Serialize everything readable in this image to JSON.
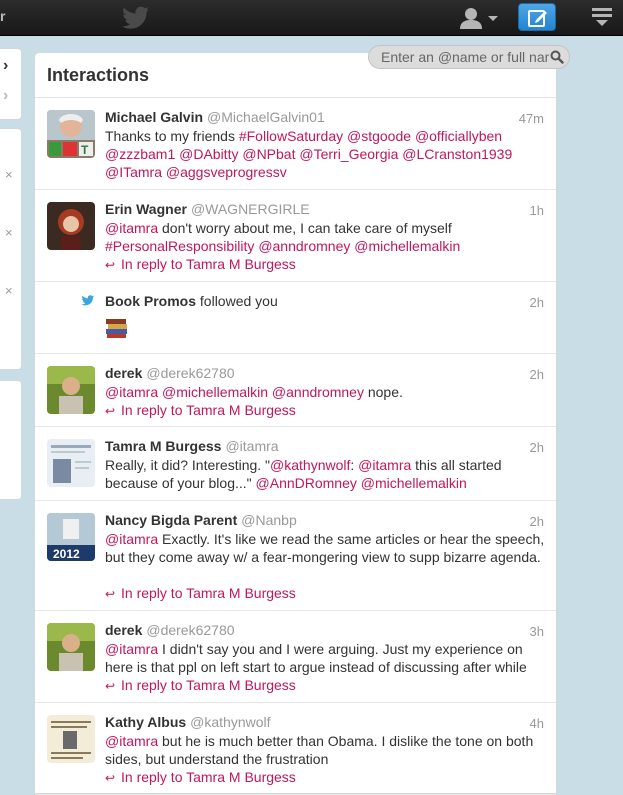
{
  "topbar": {
    "left_cut_text": "r"
  },
  "search": {
    "placeholder": "Enter an @name or full name"
  },
  "panel": {
    "title": "Interactions"
  },
  "items": [
    {
      "name": "Michael Galvin",
      "handle": "@MichaelGalvin01",
      "time": "47m",
      "segments": [
        {
          "t": "Thanks to my friends "
        },
        {
          "t": "#FollowSaturday",
          "m": 1
        },
        {
          "t": " "
        },
        {
          "t": "@stgoode",
          "m": 1
        },
        {
          "t": " "
        },
        {
          "t": "@officiallyben",
          "m": 1
        },
        {
          "t": " "
        },
        {
          "t": "@zzzbam1",
          "m": 1
        },
        {
          "t": " "
        },
        {
          "t": "@DAbitty",
          "m": 1
        },
        {
          "t": " "
        },
        {
          "t": "@NPbat",
          "m": 1
        },
        {
          "t": " "
        },
        {
          "t": "@Terri_Georgia",
          "m": 1
        },
        {
          "t": " "
        },
        {
          "t": "@LCranston1939",
          "m": 1
        },
        {
          "t": " "
        },
        {
          "t": "@ITamra",
          "m": 1
        },
        {
          "t": " "
        },
        {
          "t": "@aggsveprogressv",
          "m": 1
        }
      ],
      "reply": ""
    },
    {
      "name": "Erin Wagner",
      "handle": "@WAGNERGIRLE",
      "time": "1h",
      "segments": [
        {
          "t": "@itamra",
          "m": 1
        },
        {
          "t": " don't worry about me, I can take care of myself "
        },
        {
          "t": "#PersonalResponsibility",
          "m": 1
        },
        {
          "t": " "
        },
        {
          "t": "@anndromney",
          "m": 1
        },
        {
          "t": " "
        },
        {
          "t": "@michellemalkin",
          "m": 1
        }
      ],
      "reply": "In reply to Tamra M Burgess"
    },
    {
      "name": "Book Promos",
      "follow_text": "followed you",
      "time": "2h"
    },
    {
      "name": "derek",
      "handle": "@derek62780",
      "time": "2h",
      "segments": [
        {
          "t": "@itamra",
          "m": 1
        },
        {
          "t": " "
        },
        {
          "t": "@michellemalkin",
          "m": 1
        },
        {
          "t": " "
        },
        {
          "t": "@anndromney",
          "m": 1
        },
        {
          "t": " nope."
        }
      ],
      "reply": "In reply to Tamra M Burgess"
    },
    {
      "name": "Tamra M Burgess",
      "handle": "@itamra",
      "time": "2h",
      "segments": [
        {
          "t": "Really, it did? Interesting. \""
        },
        {
          "t": "@kathynwolf",
          "m": 1
        },
        {
          "t": ": "
        },
        {
          "t": "@itamra",
          "m": 1
        },
        {
          "t": " this all started because of your blog...\" "
        },
        {
          "t": "@AnnDRomney",
          "m": 1
        },
        {
          "t": " "
        },
        {
          "t": "@michellemalkin",
          "m": 1
        }
      ],
      "reply": ""
    },
    {
      "name": "Nancy Bigda Parent",
      "handle": "@Nanbp",
      "time": "2h",
      "avatar_text": "2012",
      "segments": [
        {
          "t": "@itamra",
          "m": 1
        },
        {
          "t": " Exactly. It's like we read the same articles or hear the speech, but they come away w/ a fear-mongering view to supp bizarre agenda."
        }
      ],
      "reply": "In reply to Tamra M Burgess"
    },
    {
      "name": "derek",
      "handle": "@derek62780",
      "time": "3h",
      "segments": [
        {
          "t": "@itamra",
          "m": 1
        },
        {
          "t": " I didn't say you and I were arguing. Just my experience on here is that ppl on left start to argue instead of discussing after while"
        }
      ],
      "reply": "In reply to Tamra M Burgess"
    },
    {
      "name": "Kathy Albus",
      "handle": "@kathynwolf",
      "time": "4h",
      "segments": [
        {
          "t": "@itamra",
          "m": 1
        },
        {
          "t": " but he is much better than Obama. I dislike the tone on both sides, but understand the frustration"
        }
      ],
      "reply": "In reply to Tamra M Burgess"
    }
  ],
  "colors": {
    "mention": "#c0175d",
    "accent": "#2384d1"
  }
}
